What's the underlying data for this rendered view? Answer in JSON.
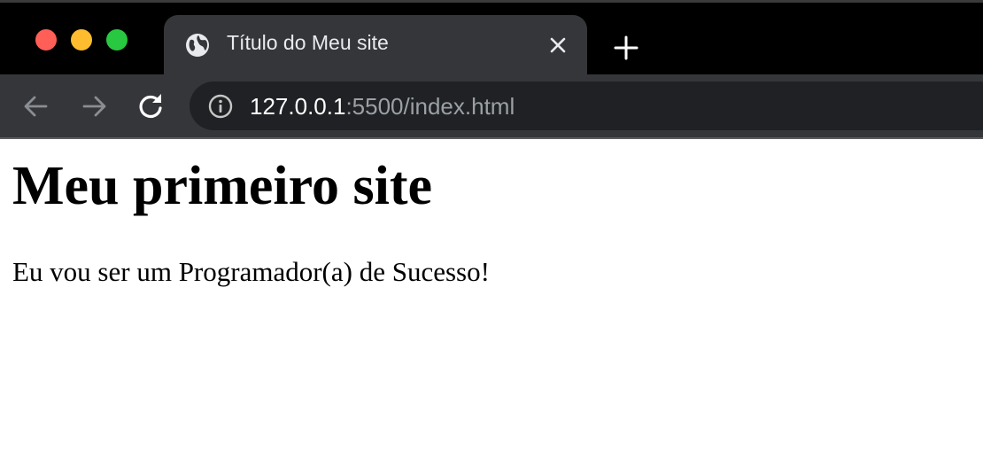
{
  "window": {
    "controls": {
      "close_color": "#ff5f57",
      "minimize_color": "#febc2e",
      "maximize_color": "#28c840"
    }
  },
  "tab": {
    "icon": "globe-icon",
    "title": "Título do Meu site",
    "close_icon": "close-icon"
  },
  "new_tab": {
    "icon": "plus-icon"
  },
  "toolbar": {
    "back_icon": "arrow-left-icon",
    "forward_icon": "arrow-right-icon",
    "reload_icon": "reload-icon"
  },
  "address_bar": {
    "info_icon": "info-icon",
    "url_host": "127.0.0.1",
    "url_rest": ":5500/index.html"
  },
  "page": {
    "heading": "Meu primeiro site",
    "paragraph": "Eu vou ser um Programador(a) de Sucesso!"
  },
  "colors": {
    "tabstrip_bg": "#000000",
    "active_tab_bg": "#35363a",
    "omnibox_bg": "#202124",
    "url_dim": "#9aa0a6"
  }
}
